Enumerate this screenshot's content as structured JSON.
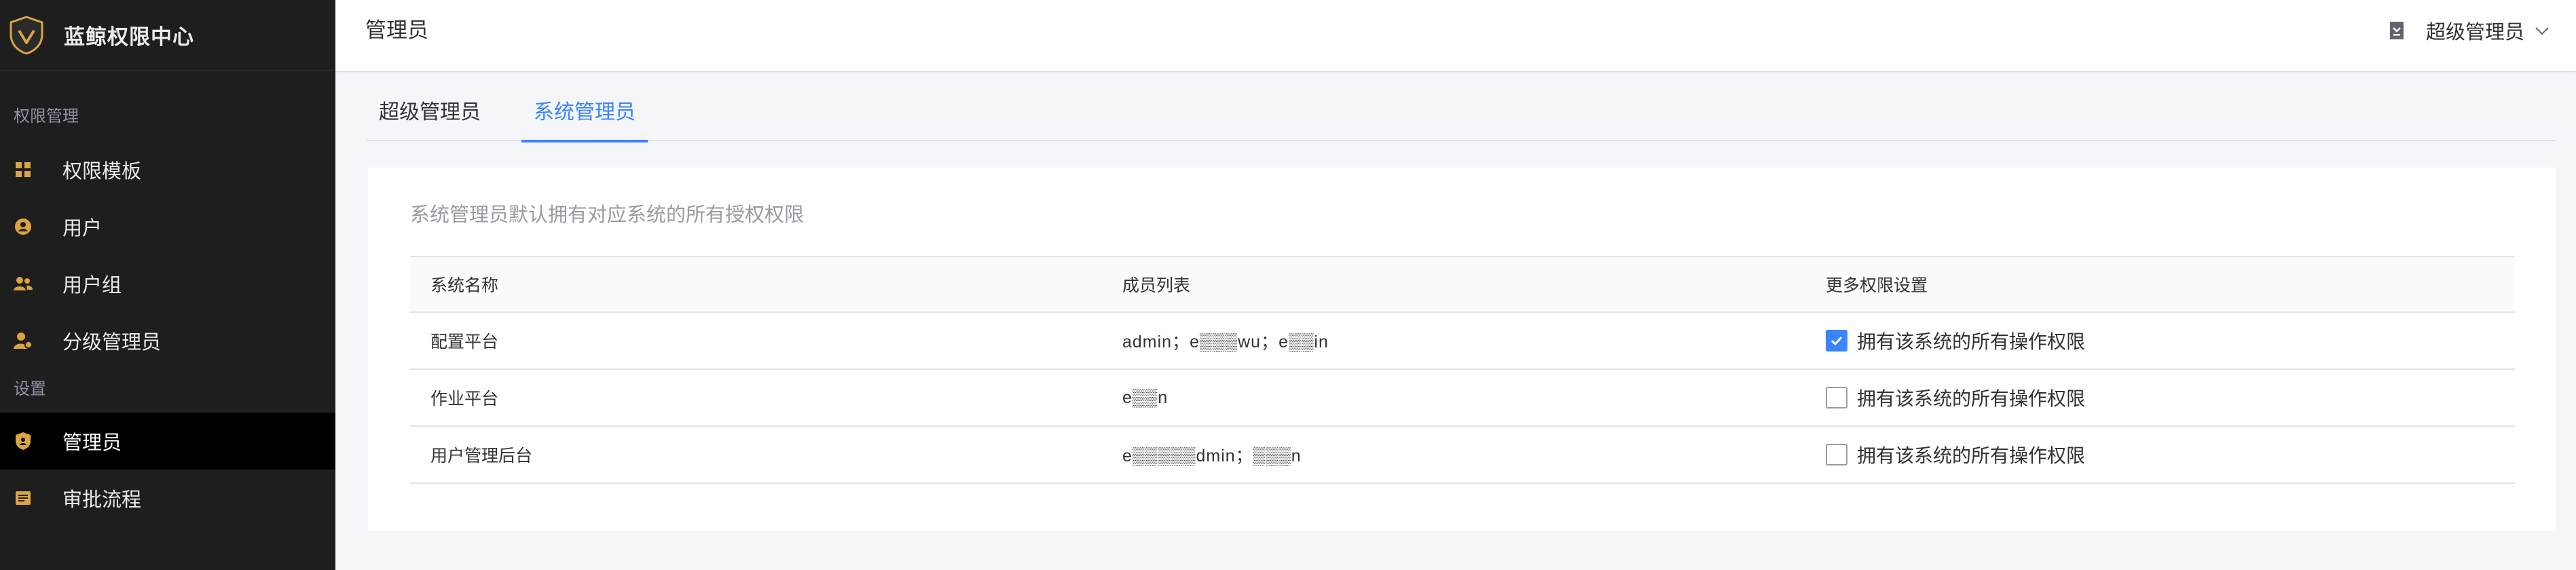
{
  "app": {
    "title": "蓝鲸权限中心"
  },
  "sidebar": {
    "groups": [
      {
        "title": "权限管理",
        "items": [
          {
            "label": "权限模板",
            "icon": "grid-icon"
          },
          {
            "label": "用户",
            "icon": "user-circle-icon"
          },
          {
            "label": "用户组",
            "icon": "user-group-icon"
          },
          {
            "label": "分级管理员",
            "icon": "user-admin-icon"
          }
        ]
      },
      {
        "title": "设置",
        "items": [
          {
            "label": "管理员",
            "icon": "shield-icon",
            "active": true
          },
          {
            "label": "审批流程",
            "icon": "approval-icon"
          }
        ]
      }
    ]
  },
  "header": {
    "title": "管理员",
    "user_role": "超级管理员",
    "doc_icon": "doc-icon"
  },
  "tabs": [
    {
      "label": "超级管理员",
      "active": false
    },
    {
      "label": "系统管理员",
      "active": true
    }
  ],
  "card": {
    "hint": "系统管理员默认拥有对应系统的所有授权权限",
    "columns": [
      "系统名称",
      "成员列表",
      "更多权限设置"
    ],
    "rows": [
      {
        "system": "配置平台",
        "members": "admin；e▒▒▒wu；e▒▒in",
        "perm_label": "拥有该系统的所有操作权限",
        "checked": true
      },
      {
        "system": "作业平台",
        "members": "e▒▒n",
        "perm_label": "拥有该系统的所有操作权限",
        "checked": false
      },
      {
        "system": "用户管理后台",
        "members": "e▒▒▒▒▒dmin；▒▒▒n",
        "perm_label": "拥有该系统的所有操作权限",
        "checked": false
      }
    ]
  },
  "colors": {
    "accent": "#3a84ff",
    "sidebar_bg": "#1e1e1e",
    "brand_gold": "#d9a441"
  }
}
